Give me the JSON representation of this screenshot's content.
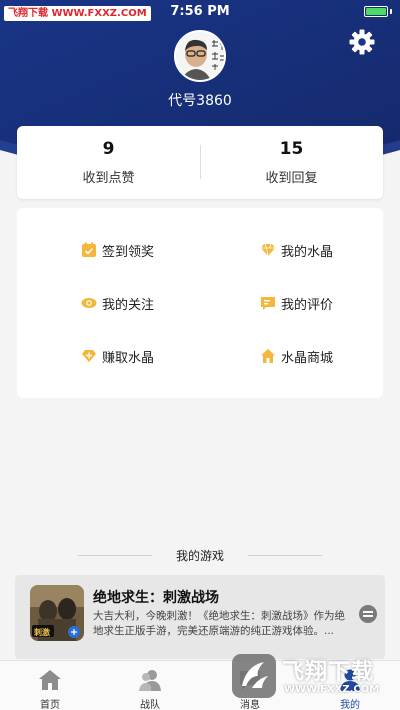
{
  "status_bar": {
    "time": "7:56 PM",
    "watermark": "飞翔下载 WWW.FXXZ.COM"
  },
  "profile": {
    "username": "代号3860"
  },
  "stats": [
    {
      "value": "9",
      "label": "收到点赞"
    },
    {
      "value": "15",
      "label": "收到回复"
    }
  ],
  "menu": [
    {
      "label": "签到领奖",
      "icon": "checkin-icon"
    },
    {
      "label": "我的水晶",
      "icon": "crystal-icon"
    },
    {
      "label": "我的关注",
      "icon": "eye-icon"
    },
    {
      "label": "我的评价",
      "icon": "comment-icon"
    },
    {
      "label": "赚取水晶",
      "icon": "earn-crystal-icon"
    },
    {
      "label": "水晶商城",
      "icon": "store-icon"
    }
  ],
  "games_section": {
    "title": "我的游戏",
    "game": {
      "name": "绝地求生：刺激战场",
      "description": "大吉大利，今晚刺激！《绝地求生：刺激战场》作为绝地求生正版手游，完美还原端游的纯正游戏体验。...",
      "icon_text": "刺激"
    }
  },
  "tabs": [
    {
      "label": "首页",
      "icon": "home-icon",
      "active": false
    },
    {
      "label": "战队",
      "icon": "team-icon",
      "active": false
    },
    {
      "label": "消息",
      "icon": "message-icon",
      "active": false
    },
    {
      "label": "我的",
      "icon": "profile-icon",
      "active": true
    }
  ],
  "watermark_bottom": {
    "title": "飞翔下载",
    "url": "WWW.FXXZ.COM"
  },
  "colors": {
    "header": "#1d3a8a",
    "accent": "#f5b63a",
    "active_tab": "#234aa5"
  }
}
